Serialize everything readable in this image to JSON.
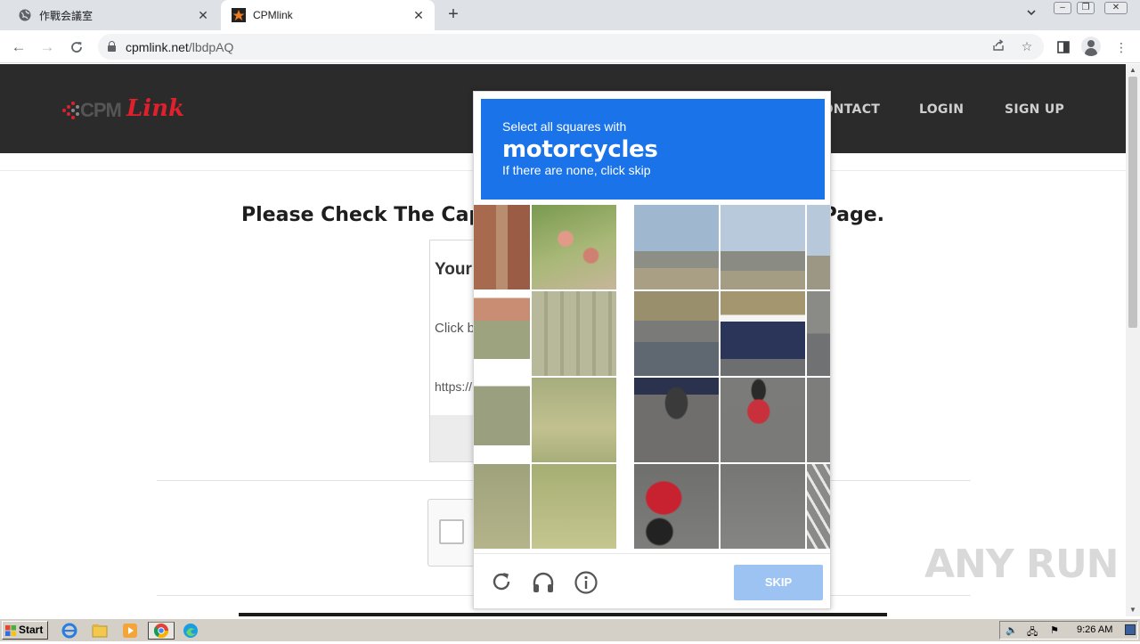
{
  "browser": {
    "tabs": [
      {
        "title": "作戰会議室",
        "active": false
      },
      {
        "title": "CPMlink",
        "active": true
      }
    ],
    "url_domain": "cpmlink.net",
    "url_path": "/lbdpAQ"
  },
  "site": {
    "logo_text_1": "CPM",
    "logo_text_2": "Link",
    "nav": [
      "CONTACT",
      "LOGIN",
      "SIGN UP"
    ],
    "heading": "Please Check The Captcha Below To Get Destination Page.",
    "card_title": "Your Destination Link",
    "card_text": "Click below to continue",
    "card_url": "https://"
  },
  "captcha": {
    "prompt_line1": "Select all squares with",
    "prompt_target": "motorcycles",
    "prompt_line3": "If there are none, click skip",
    "skip_label": "SKIP",
    "colors": {
      "header": "#1a73e8",
      "skip": "#9dc3f2"
    }
  },
  "watermark": "ANY RUN",
  "taskbar": {
    "start_label": "Start",
    "clock": "9:26 AM"
  }
}
